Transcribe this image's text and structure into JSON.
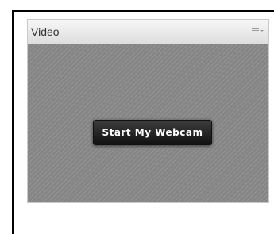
{
  "pod": {
    "title": "Video",
    "menu_icon": "menu-lines-chevron-icon"
  },
  "video": {
    "start_button_label": "Start My Webcam"
  },
  "colors": {
    "header_top": "#f7f7f7",
    "header_bottom": "#dedede",
    "video_background": "#8a8a8a",
    "button_background": "#1f1f1f",
    "button_text": "#ffffff"
  }
}
